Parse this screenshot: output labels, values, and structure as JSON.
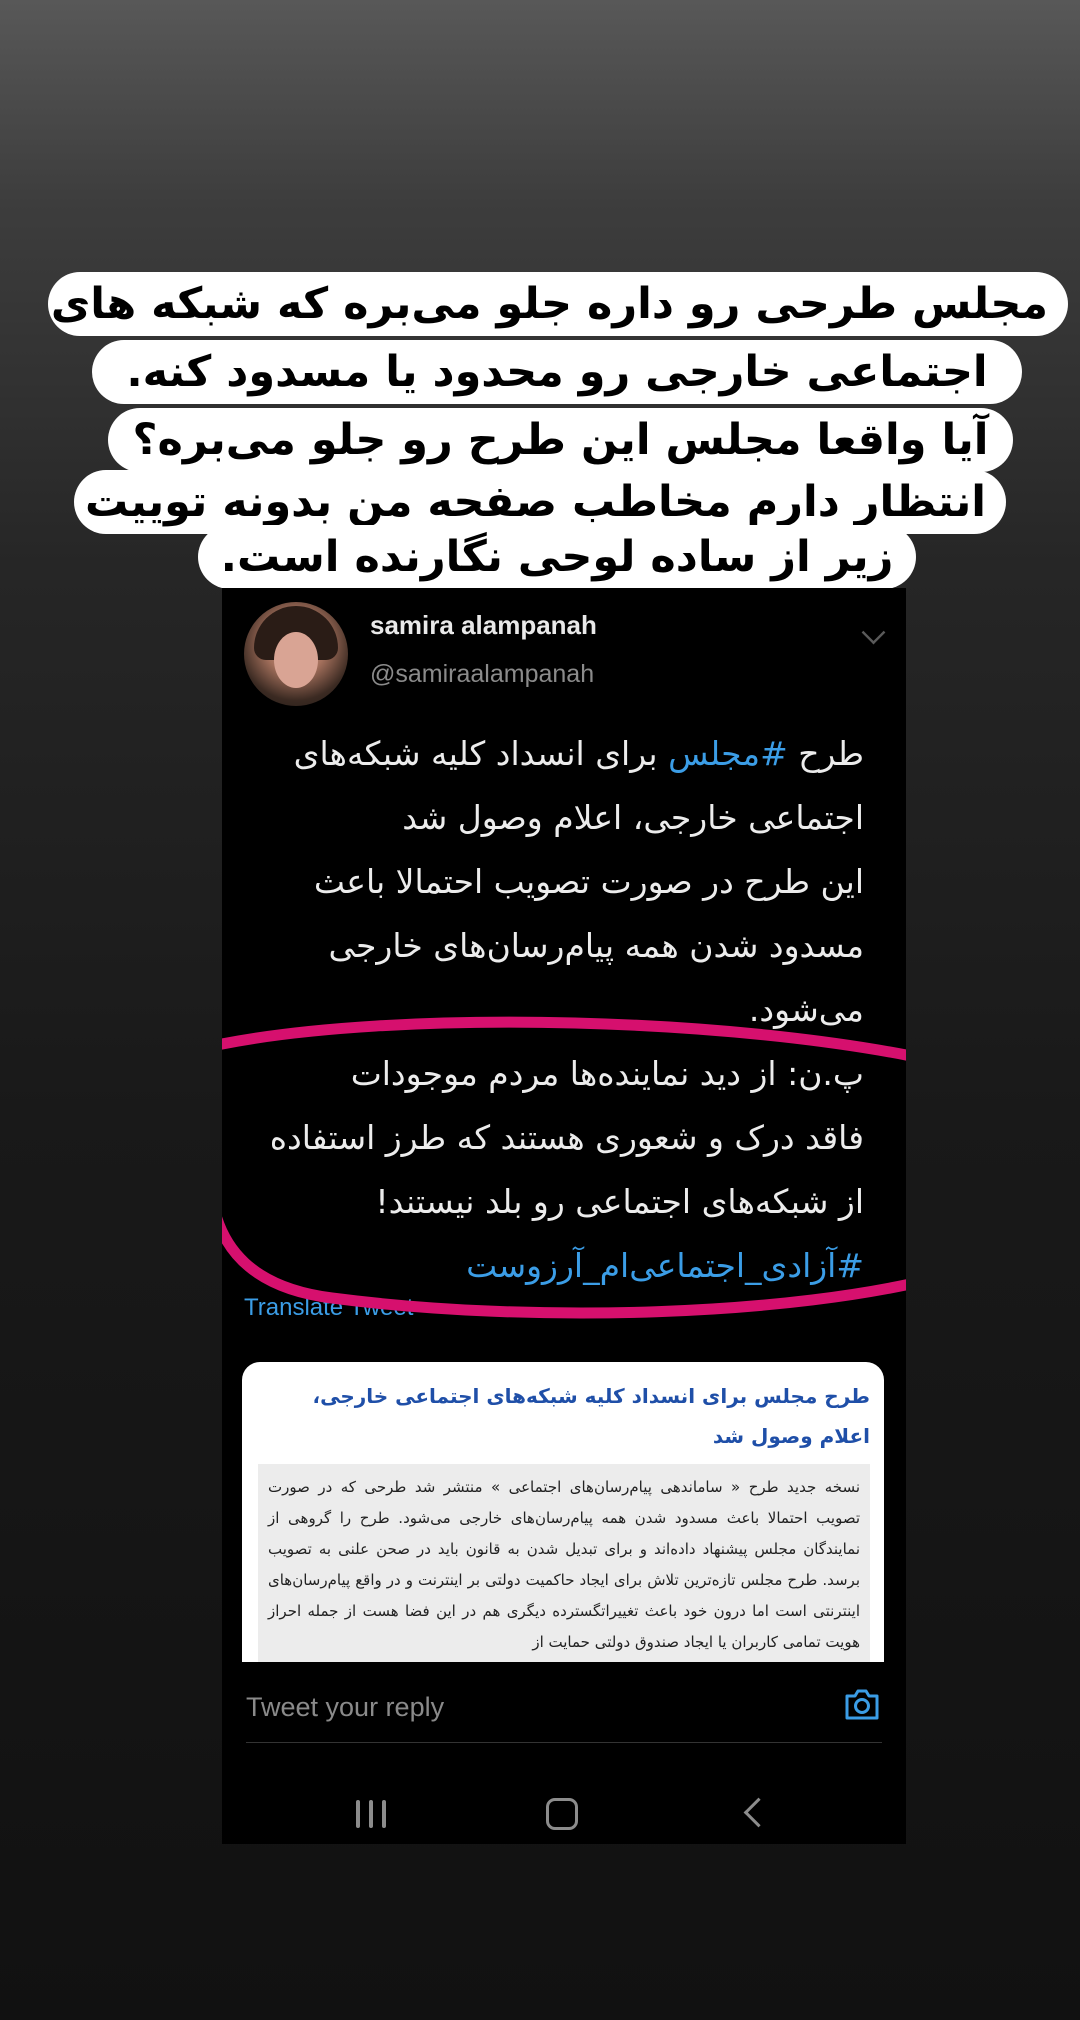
{
  "caption": {
    "lines": [
      "مجلس طرحی رو داره جلو می‌بره که شبکه های",
      "اجتماعی خارجی رو محدود یا مسدود کنه.",
      "آیا واقعا مجلس این طرح رو جلو می‌بره؟",
      "انتظار دارم مخاطب صفحه من بدونه توییت",
      "زیر از ساده لوحی نگارنده است."
    ]
  },
  "tweet": {
    "display_name": "samira alampanah",
    "handle": "@samiraalampanah",
    "line1_prefix": "طرح ",
    "line1_hashtag": "#مجلس",
    "line1_suffix": " برای انسداد کلیه شبکه‌های",
    "line2": "اجتماعی خارجی، اعلام وصول شد",
    "line3": "این طرح در صورت تصویب احتمالا باعث",
    "line4": "مسدود شدن همه پیام‌رسان‌های خارجی",
    "line5": "می‌شود.",
    "line6": "پ.ن:  از دید نماینده‌ها مردم موجودات",
    "line7": "فاقد درک و شعوری هستند که طرز استفاده",
    "line8": "از شبکه‌های اجتماعی رو بلد نیستند!",
    "hashtag2": "#آزادی_اجتماعی‌ام_آرزوست",
    "translate_label": "Translate Tweet",
    "highlight_color": "#d6106e"
  },
  "link_card": {
    "title": "طرح مجلس برای انسداد کلیه شبکه‌های اجتماعی خارجی، اعلام وصول شد",
    "body": "نسخه جدید طرح « ساماندهی پیام‌رسان‌های اجتماعی » منتشر شد طرحی که در صورت تصویب احتمالا باعث مسدود شدن همه پیام‌رسان‌های خارجی می‌شود. طرح را گروهی از نمایندگان مجلس پیشنهاد داده‌اند و برای تبدیل شدن به قانون باید در صحن علنی به تصویب برسد. طرح مجلس تازه‌ترین تلاش برای ایجاد حاکمیت دولتی بر اینترنت و در واقع پیام‌رسان‌های اینترنتی است اما درون خود باعث تغییراتگسترده دیگری هم در این فضا هست از جمله احراز هویت تمامی کاربران یا ایجاد صندوق دولتی حمایت از"
  },
  "reply": {
    "placeholder": "Tweet your reply",
    "camera_icon": "camera-icon"
  },
  "navbar": {
    "icons": [
      "recents-icon",
      "home-icon",
      "back-icon"
    ]
  },
  "colors": {
    "link_blue": "#3b9de6",
    "card_title_blue": "#1f4fa8"
  }
}
